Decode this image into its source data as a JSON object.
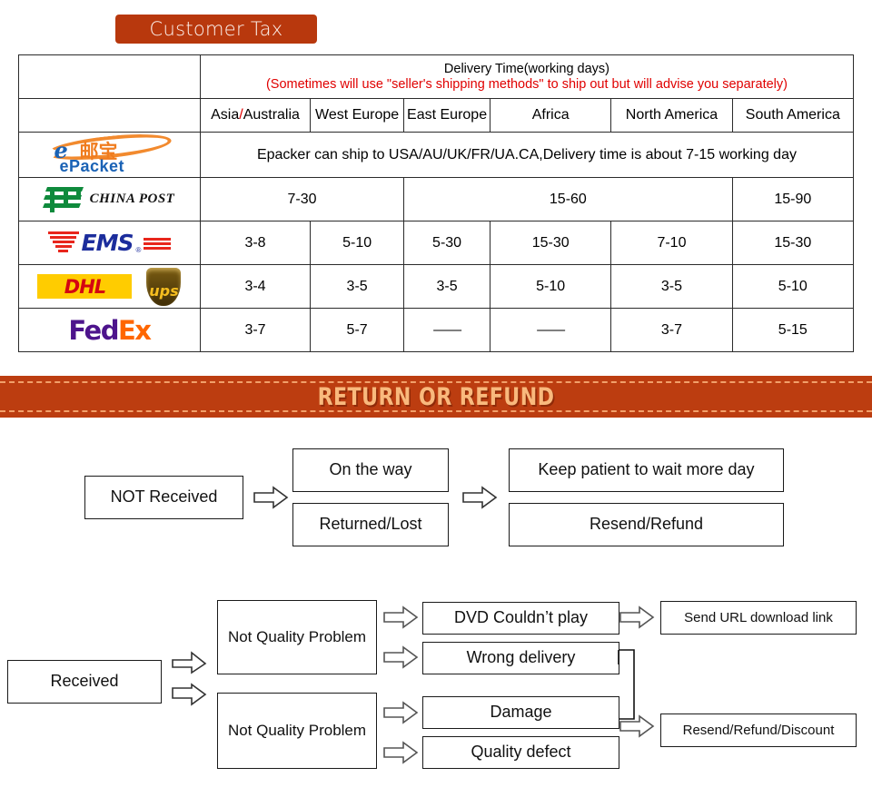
{
  "badge": {
    "label": "Customer Tax",
    "color": "#b8380d"
  },
  "shipping_table": {
    "header": {
      "main_line": "Delivery Time(working days)",
      "note_line": "(Sometimes will use \"seller's shipping methods\" to ship out but will advise you separately)",
      "note_color": "#e00000"
    },
    "columns": [
      {
        "label_a": "Asia",
        "slash": "/",
        "label_b": "Australia",
        "name": "asia-australia"
      },
      {
        "label": "West Europe",
        "name": "west-europe"
      },
      {
        "label": "East Europe",
        "name": "east-europe"
      },
      {
        "label": "Africa",
        "name": "africa"
      },
      {
        "label": "North America",
        "name": "north-america"
      },
      {
        "label": "South America",
        "name": "south-america"
      }
    ],
    "rows": [
      {
        "carrier": "epacket",
        "logo_name": "epacket-logo",
        "logo_text": {
          "e": "e",
          "cn": "邮宝",
          "word": "ePacket"
        },
        "spanned_note": "Epacker can ship to USA/AU/UK/FR/UA.CA,Delivery time is about 7-15 working day"
      },
      {
        "carrier": "china-post",
        "logo_name": "china-post-logo",
        "logo_text": "CHINA POST",
        "groups": [
          {
            "value": "7-30",
            "span": 2
          },
          {
            "value": "15-60",
            "span": 3
          },
          {
            "value": "15-90",
            "span": 1
          }
        ]
      },
      {
        "carrier": "ems",
        "logo_name": "ems-logo",
        "logo_text": "EMS",
        "values": [
          "3-8",
          "5-10",
          "5-30",
          "15-30",
          "7-10",
          "15-30"
        ]
      },
      {
        "carrier": "dhl-ups",
        "logo_name": "dhl-ups-logo",
        "logo_text": {
          "dhl": "DHL",
          "ups": "ups"
        },
        "values": [
          "3-4",
          "3-5",
          "3-5",
          "5-10",
          "3-5",
          "5-10"
        ]
      },
      {
        "carrier": "fedex",
        "logo_name": "fedex-logo",
        "logo_text": {
          "fed": "Fed",
          "ex": "Ex"
        },
        "values": [
          "3-7",
          "5-7",
          "——",
          "——",
          "3-7",
          "5-15"
        ]
      }
    ]
  },
  "banner": {
    "title": "RETURN OR REFUND",
    "bg": "#bc3d10",
    "text_color": "#f9b97d"
  },
  "flow_not_received": {
    "source": "NOT Received",
    "states": [
      "On the way",
      "Returned/Lost"
    ],
    "actions": [
      "Keep patient to wait more day",
      "Resend/Refund"
    ]
  },
  "flow_received": {
    "source": "Received",
    "categories": [
      "Not Quality Problem",
      "Not Quality Problem"
    ],
    "issues": [
      "DVD Couldn’t play",
      "Wrong delivery",
      "Damage",
      "Quality defect"
    ],
    "resolutions": [
      "Send URL download link",
      "Resend/Refund/Discount"
    ]
  }
}
